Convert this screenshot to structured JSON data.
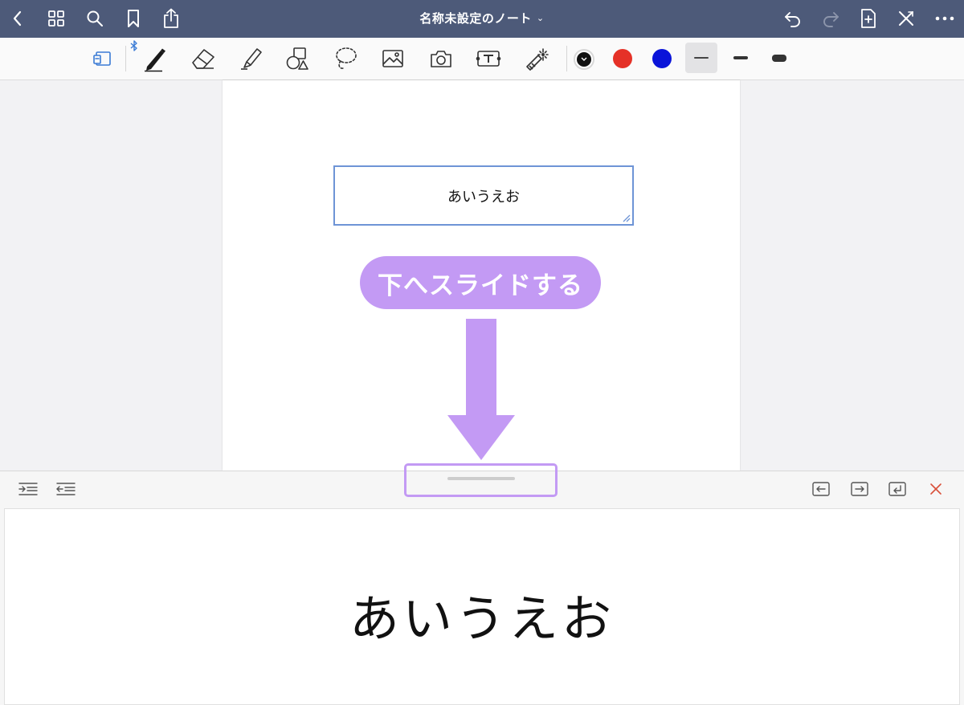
{
  "app": {
    "title": "名称未設定のノート",
    "title_chevron": "⌄"
  },
  "nav": {
    "left_icons": [
      "back-icon",
      "grid-icon",
      "search-icon",
      "bookmark-icon",
      "share-icon"
    ],
    "right_icons": [
      "undo-icon",
      "redo-icon",
      "add-page-icon",
      "close-toolbar-icon",
      "more-icon"
    ]
  },
  "toolbar": {
    "tools": [
      "view-switch",
      "pen",
      "eraser",
      "highlighter",
      "shapes",
      "lasso",
      "image",
      "camera",
      "text",
      "laser-pointer"
    ],
    "bluetooth_indicator": "bluetooth-icon",
    "colors": [
      "#111111",
      "#e53127",
      "#0a14d9"
    ],
    "selected_color": "#111111",
    "stroke_widths": [
      "thin",
      "medium",
      "thick"
    ],
    "selected_width": "thin"
  },
  "canvas": {
    "textbox_text": "あいうえお",
    "callout_text": "下へスライドする",
    "accent_color": "#c39af4"
  },
  "panel": {
    "left_icons": [
      "indent-icon",
      "outdent-icon"
    ],
    "right_icons": [
      "move-left-icon",
      "move-right-icon",
      "return-icon",
      "close-icon"
    ],
    "editor_text": "あいうえお"
  }
}
